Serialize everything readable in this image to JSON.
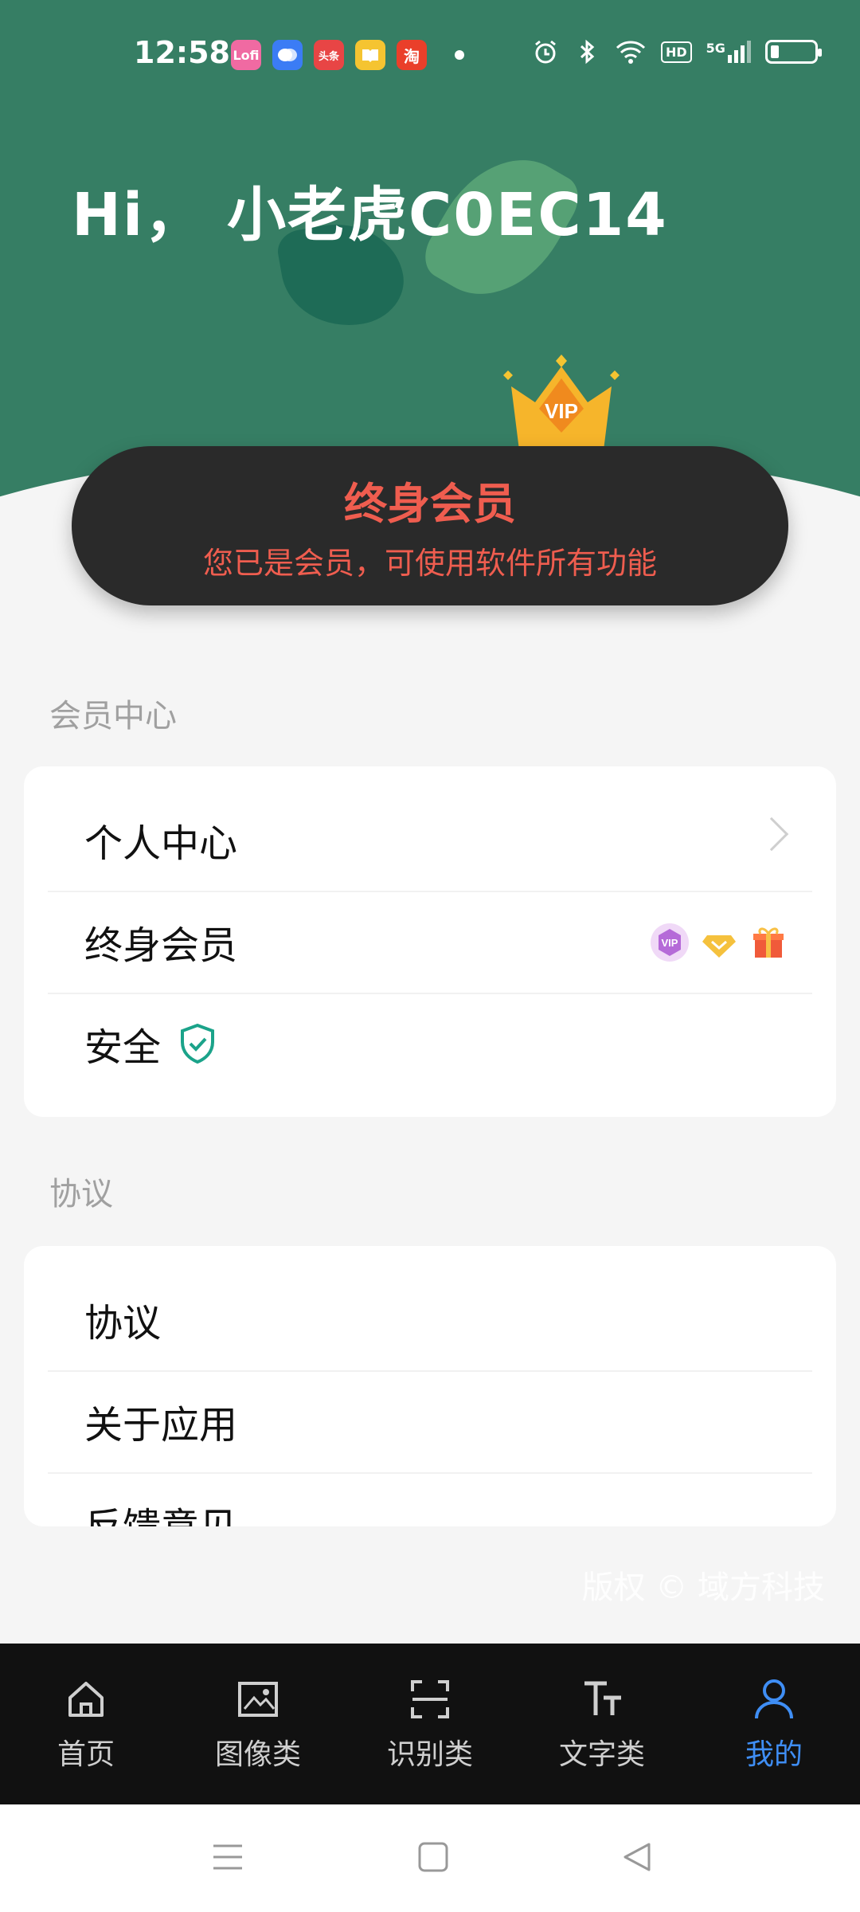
{
  "status_bar": {
    "time": "12:58",
    "app_icons": [
      {
        "name": "lofter-app-icon",
        "text": "Lofi",
        "color": "#f06aa2"
      },
      {
        "name": "chat-app-icon",
        "text": "",
        "color": "#3b7cf5"
      },
      {
        "name": "toutiao-app-icon",
        "text": "头条",
        "color": "#e84545"
      },
      {
        "name": "reader-app-icon",
        "text": "",
        "color": "#f5c431"
      },
      {
        "name": "taobao-app-icon",
        "text": "淘",
        "color": "#ea3f2a"
      }
    ],
    "sys_icons": [
      "alarm-icon",
      "bluetooth-icon",
      "wifi-icon",
      "hd-icon",
      "signal-5g-icon"
    ],
    "hd_text": "HD",
    "net_text": "5G"
  },
  "header": {
    "greeting": "Hi，  小老虎C0EC14"
  },
  "vip_card": {
    "crown_text": "VIP",
    "title": "终身会员",
    "subtitle": "您已是会员，可使用软件所有功能"
  },
  "sections": {
    "member_center_label": "会员中心",
    "member_items": [
      {
        "label": "个人中心"
      },
      {
        "label": "终身会员"
      },
      {
        "label": "安全"
      }
    ],
    "agreement_label": "协议",
    "agreement_items": [
      {
        "label": "协议"
      },
      {
        "label": "关于应用"
      },
      {
        "label": "反馈意见"
      }
    ]
  },
  "copyright": "版权 © 域方科技",
  "bottom_nav": [
    {
      "label": "首页",
      "icon": "home-icon"
    },
    {
      "label": "图像类",
      "icon": "image-icon"
    },
    {
      "label": "识别类",
      "icon": "scan-icon"
    },
    {
      "label": "文字类",
      "icon": "text-icon"
    },
    {
      "label": "我的",
      "icon": "profile-icon",
      "active": true
    }
  ],
  "colors": {
    "header_green": "#367e64",
    "vip_red": "#ef5d4f",
    "active_blue": "#3f8ef5"
  }
}
